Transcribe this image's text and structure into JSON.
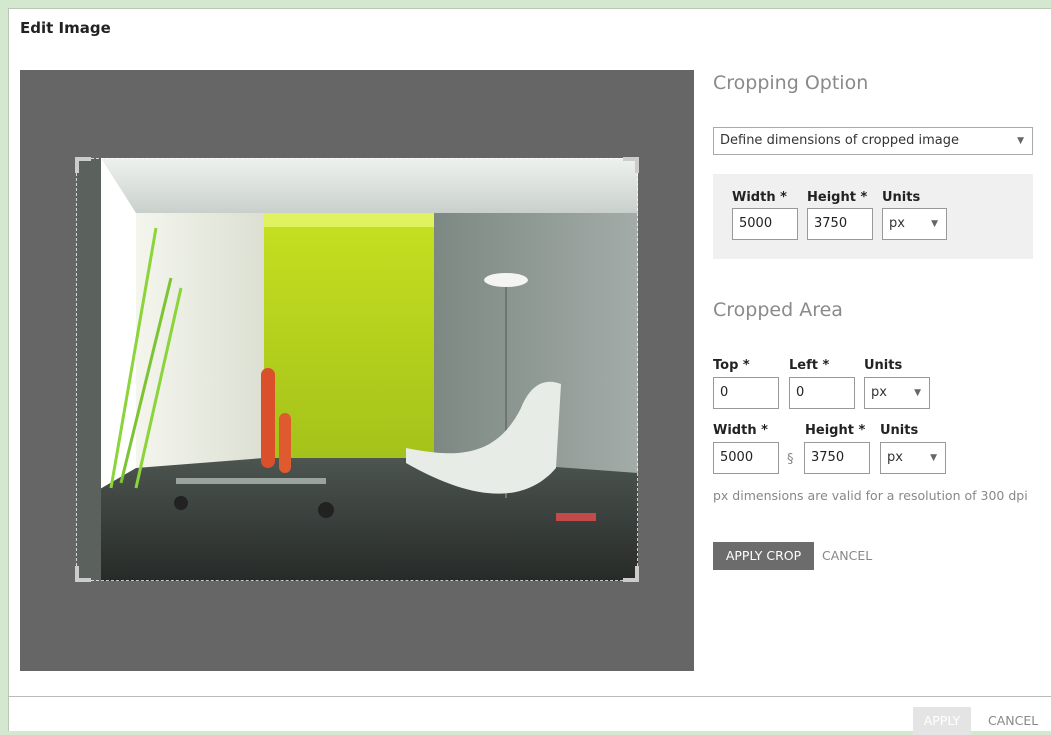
{
  "dialog": {
    "title": "Edit Image"
  },
  "image": {
    "description_icon": "room-photo"
  },
  "cropping_option": {
    "title": "Cropping Option",
    "mode_select": "Define dimensions of cropped image",
    "width_label": "Width *",
    "height_label": "Height *",
    "units_label": "Units",
    "width_value": "5000",
    "height_value": "3750",
    "units_value": "px"
  },
  "cropped_area": {
    "title": "Cropped Area",
    "top_label": "Top *",
    "left_label": "Left *",
    "units_label": "Units",
    "top_value": "0",
    "left_value": "0",
    "units_value": "px",
    "width_label": "Width *",
    "height_label": "Height *",
    "units2_label": "Units",
    "width_value": "5000",
    "height_value": "3750",
    "units2_value": "px",
    "note": "px dimensions are valid for a resolution of 300 dpi",
    "apply_crop": "APPLY CROP",
    "cancel": "CANCEL"
  },
  "footer": {
    "apply": "APPLY",
    "cancel": "CANCEL"
  },
  "colors": {
    "stage": "#666666",
    "accent_green": "#b8d81e",
    "button_dark": "#6c6c6c"
  }
}
